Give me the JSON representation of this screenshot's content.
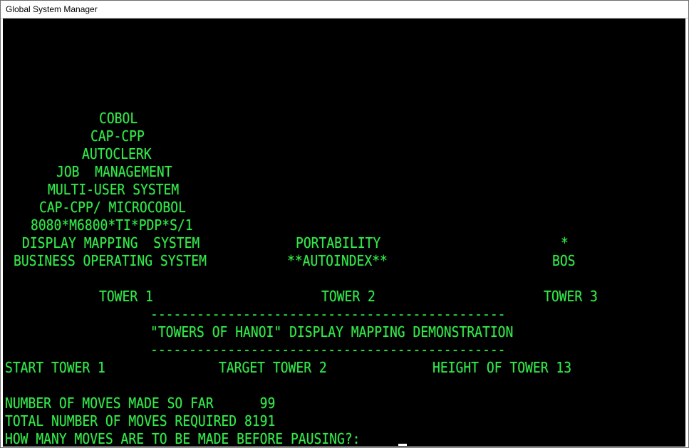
{
  "window": {
    "title": "Global System Manager"
  },
  "terminal": {
    "pyramid": {
      "line1": "COBOL",
      "line2": "CAP-CPP",
      "line3": "AUTOCLERK",
      "line4": "JOB  MANAGEMENT",
      "line5": "MULTI-USER SYSTEM",
      "line6": "CAP-CPP/ MICROCOBOL",
      "line7": "8080*M6800*TI*PDP*S/1",
      "line8": "DISPLAY MAPPING  SYSTEM",
      "line9": "BUSINESS OPERATING SYSTEM"
    },
    "tower2_stack": {
      "line1": "PORTABILITY",
      "line2": "**AUTOINDEX**"
    },
    "tower3_stack": {
      "line1": "*",
      "line2": "BOS"
    },
    "tower_labels": {
      "tower1": "TOWER 1",
      "tower2": "TOWER 2",
      "tower3": "TOWER 3"
    },
    "banner": {
      "rule_top": "----------------------------------------------",
      "title": "\"TOWERS OF HANOI\" DISPLAY MAPPING DEMONSTRATION",
      "rule_bottom": "----------------------------------------------"
    },
    "params": {
      "start": "START TOWER 1",
      "target": "TARGET TOWER 2",
      "height": "HEIGHT OF TOWER 13"
    },
    "status": {
      "moves_made": "NUMBER OF MOVES MADE SO FAR      99",
      "moves_required": "TOTAL NUMBER OF MOVES REQUIRED 8191",
      "prompt": "HOW MANY MOVES ARE TO BE MADE BEFORE PAUSING?:"
    }
  }
}
